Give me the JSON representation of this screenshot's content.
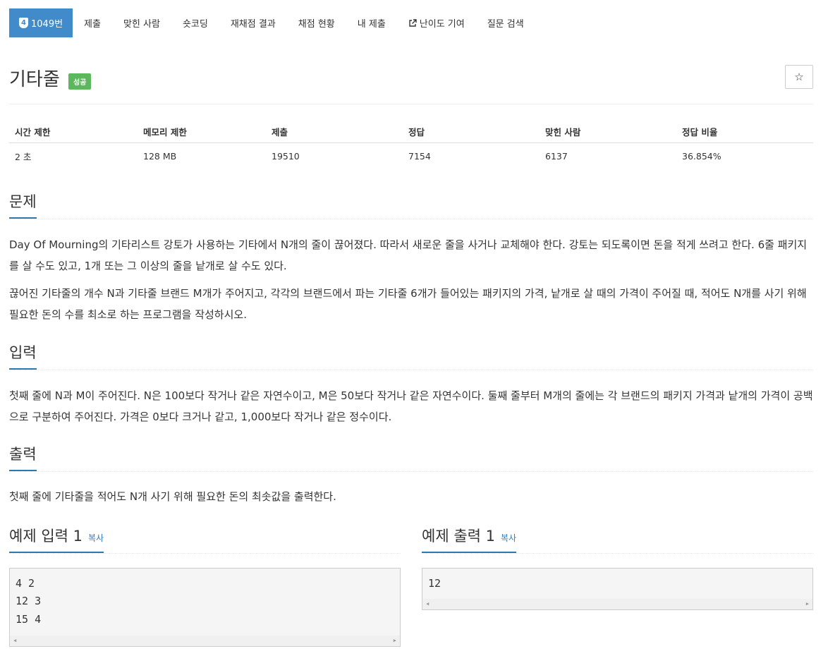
{
  "nav": {
    "problem_badge": "4",
    "tabs": [
      "1049번",
      "제출",
      "맞힌 사람",
      "숏코딩",
      "재채점 결과",
      "채점 현황",
      "내 제출",
      "난이도 기여",
      "질문 검색"
    ]
  },
  "problem": {
    "title": "기타줄",
    "status": "성공",
    "star": "☆"
  },
  "info": {
    "headers": [
      "시간 제한",
      "메모리 제한",
      "제출",
      "정답",
      "맞힌 사람",
      "정답 비율"
    ],
    "values": [
      "2 초",
      "128 MB",
      "19510",
      "7154",
      "6137",
      "36.854%"
    ]
  },
  "sections": {
    "description_title": "문제",
    "description_p1": "Day Of Mourning의 기타리스트 강토가 사용하는 기타에서 N개의 줄이 끊어졌다. 따라서 새로운 줄을 사거나 교체해야 한다. 강토는 되도록이면 돈을 적게 쓰려고 한다. 6줄 패키지를 살 수도 있고, 1개 또는 그 이상의 줄을 낱개로 살 수도 있다.",
    "description_p2": "끊어진 기타줄의 개수 N과 기타줄 브랜드 M개가 주어지고, 각각의 브랜드에서 파는 기타줄 6개가 들어있는 패키지의 가격, 낱개로 살 때의 가격이 주어질 때, 적어도 N개를 사기 위해 필요한 돈의 수를 최소로 하는 프로그램을 작성하시오.",
    "input_title": "입력",
    "input_text": "첫째 줄에 N과 M이 주어진다. N은 100보다 작거나 같은 자연수이고, M은 50보다 작거나 같은 자연수이다. 둘째 줄부터 M개의 줄에는 각 브랜드의 패키지 가격과 낱개의 가격이 공백으로 구분하여 주어진다. 가격은 0보다 크거나 같고, 1,000보다 작거나 같은 정수이다.",
    "output_title": "출력",
    "output_text": "첫째 줄에 기타줄을 적어도 N개 사기 위해 필요한 돈의 최솟값을 출력한다."
  },
  "samples": {
    "input_title": "예제 입력 1",
    "output_title": "예제 출력 1",
    "copy_label": "복사",
    "input_lines": [
      "4 2",
      "12 3",
      "15 4"
    ],
    "output_lines": [
      "12"
    ]
  },
  "colors": {
    "accent": "#428bca",
    "success": "#5cb85c",
    "headline_underline": "#2a7ab0",
    "link": "#337ab7"
  }
}
